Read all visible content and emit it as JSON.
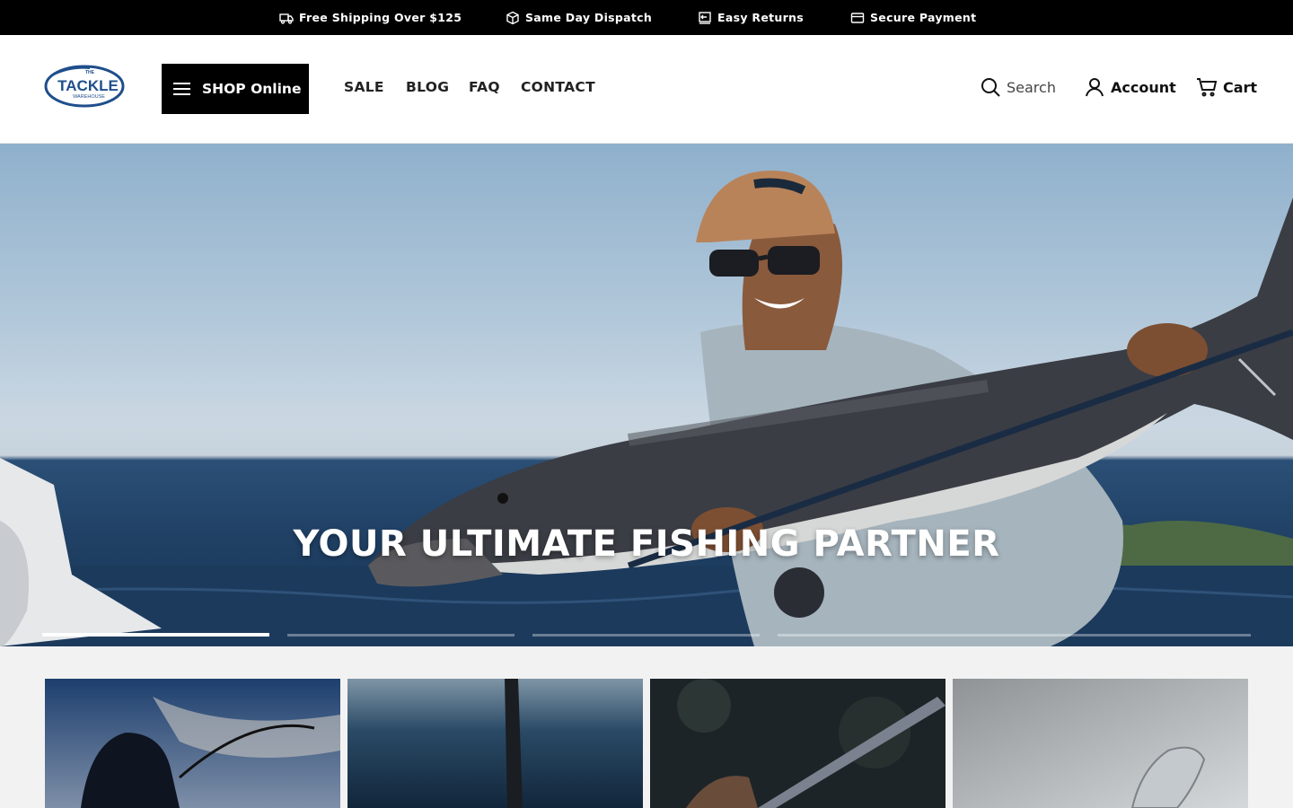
{
  "topbar": {
    "items": [
      {
        "icon": "truck-icon",
        "label": "Free Shipping Over $125"
      },
      {
        "icon": "box-icon",
        "label": "Same Day Dispatch"
      },
      {
        "icon": "return-icon",
        "label": "Easy Returns"
      },
      {
        "icon": "card-icon",
        "label": "Secure Payment"
      }
    ]
  },
  "header": {
    "logo": {
      "small_top": "THE",
      "main": "TACKLE",
      "small_bottom": "WAREHOUSE"
    },
    "shop_button": "SHOP Online",
    "nav": [
      "SALE",
      "BLOG",
      "FAQ",
      "CONTACT"
    ],
    "search_label": "Search",
    "account_label": "Account",
    "cart_label": "Cart"
  },
  "hero": {
    "title": "YOUR ULTIMATE FISHING PARTNER",
    "slides_total": 4,
    "active_slide": 1
  },
  "colors": {
    "topbar_bg": "#000000",
    "accent_dark": "#000000",
    "logo_blue": "#1f4e8c",
    "page_bg": "#f2f2f2"
  }
}
